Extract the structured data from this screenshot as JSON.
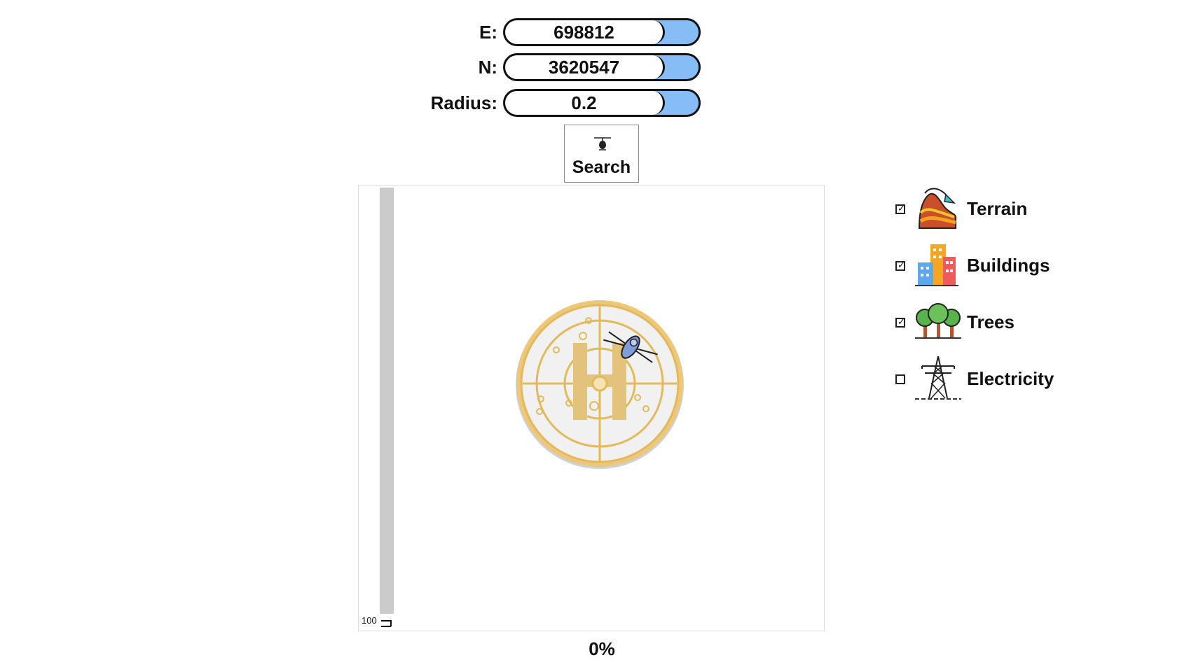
{
  "fields": [
    {
      "label": "E:",
      "value": "698812"
    },
    {
      "label": "N:",
      "value": "3620547"
    },
    {
      "label": "Radius:",
      "value": "0.2"
    }
  ],
  "search": {
    "label": "Search"
  },
  "map": {
    "scale_label": "100"
  },
  "progress": {
    "text": "0%",
    "value_percent": 0
  },
  "layers": [
    {
      "label": "Terrain",
      "checked": true,
      "icon": "terrain-icon"
    },
    {
      "label": "Buildings",
      "checked": true,
      "icon": "buildings-icon"
    },
    {
      "label": "Trees",
      "checked": true,
      "icon": "trees-icon"
    },
    {
      "label": "Electricity",
      "checked": false,
      "icon": "electricity-tower-icon"
    }
  ],
  "colors": {
    "pill_accent": "#86bdf7",
    "pad_gold": "#e9c677",
    "scrollbar": "#cbcbcb"
  }
}
